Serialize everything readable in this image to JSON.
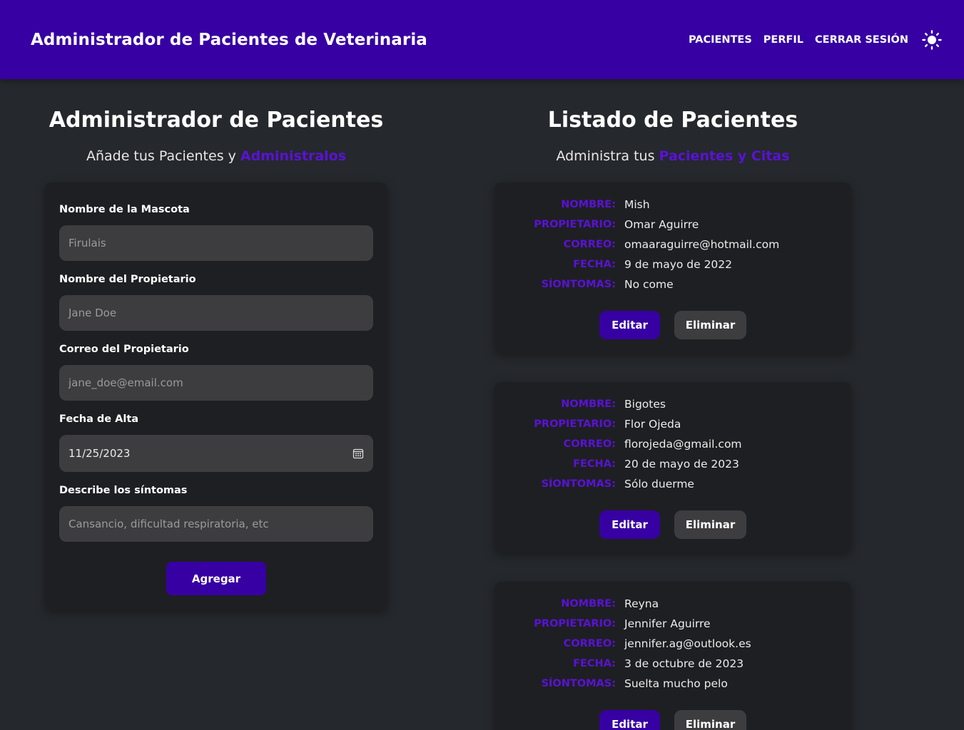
{
  "header": {
    "title": "Administrador de Pacientes de Veterinaria",
    "nav": [
      "Pacientes",
      "Perfil",
      "Cerrar Sesión"
    ],
    "theme_icon": "sun-icon"
  },
  "form_section": {
    "title": "Administrador de Pacientes",
    "subtitle_prefix": "Añade tus Pacientes y ",
    "subtitle_accent": "Administralos",
    "fields": [
      {
        "label": "Nombre de la Mascota",
        "placeholder": "Firulais",
        "value": ""
      },
      {
        "label": "Nombre del Propietario",
        "placeholder": "Jane Doe",
        "value": ""
      },
      {
        "label": "Correo del Propietario",
        "placeholder": "jane_doe@email.com",
        "value": ""
      },
      {
        "label": "Fecha de Alta",
        "placeholder": "",
        "value": "11/25/2023"
      },
      {
        "label": "Describe los síntomas",
        "placeholder": "Cansancio, dificultad respiratoria, etc",
        "value": ""
      }
    ],
    "submit_label": "Agregar"
  },
  "list_section": {
    "title": "Listado de Pacientes",
    "subtitle_prefix": "Administra tus ",
    "subtitle_accent": "Pacientes y Citas",
    "keys": {
      "nombre": "Nombre:",
      "propietario": "Propietario:",
      "correo": "Correo:",
      "fecha": "Fecha:",
      "sintomas": "Síontomas:"
    },
    "edit_label": "Editar",
    "delete_label": "Eliminar",
    "patients": [
      {
        "nombre": "Mish",
        "propietario": "Omar Aguirre",
        "correo": "omaaraguirre@hotmail.com",
        "fecha": "9 de mayo de 2022",
        "sintomas": "No come"
      },
      {
        "nombre": "Bigotes",
        "propietario": "Flor Ojeda",
        "correo": "florojeda@gmail.com",
        "fecha": "20 de mayo de 2023",
        "sintomas": "Sólo duerme"
      },
      {
        "nombre": "Reyna",
        "propietario": "Jennifer Aguirre",
        "correo": "jennifer.ag@outlook.es",
        "fecha": "3 de octubre de 2023",
        "sintomas": "Suelta mucho pelo"
      }
    ]
  },
  "colors": {
    "primary": "#3700a3",
    "accent": "#5a12d6",
    "background": "#25282c",
    "card": "#1e1f22",
    "input": "#3d3d3f"
  }
}
